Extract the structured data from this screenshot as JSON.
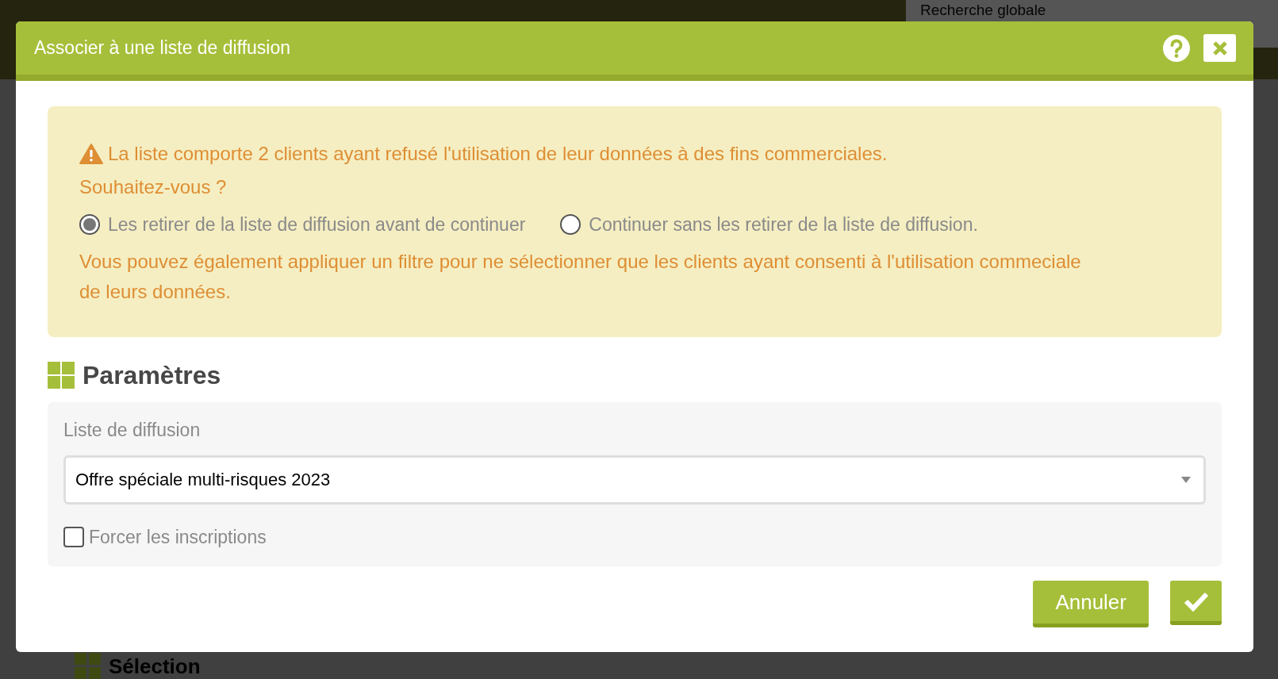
{
  "background": {
    "search": {
      "placeholder": "Recherche globale"
    },
    "section_title": "Sélection"
  },
  "dialog": {
    "title": "Associer à une liste de diffusion",
    "alert": {
      "message": "La liste comporte 2 clients ayant refusé l'utilisation de leur données à des fins commerciales.",
      "question": "Souhaitez-vous ?",
      "options": [
        {
          "label": "Les retirer de la liste de diffusion avant de continuer",
          "selected": true
        },
        {
          "label": "Continuer sans les retirer de la liste de diffusion.",
          "selected": false
        }
      ],
      "note": "Vous pouvez également appliquer un filtre pour ne sélectionner que les clients ayant consenti à l'utilisation commeciale de leurs données."
    },
    "section_title": "Paramètres",
    "field": {
      "label": "Liste de diffusion",
      "value": "Offre spéciale multi-risques 2023"
    },
    "checkbox": {
      "label": "Forcer les inscriptions",
      "checked": false
    },
    "buttons": [
      {
        "kind": "text",
        "label": "Annuler"
      },
      {
        "kind": "confirm"
      }
    ]
  }
}
